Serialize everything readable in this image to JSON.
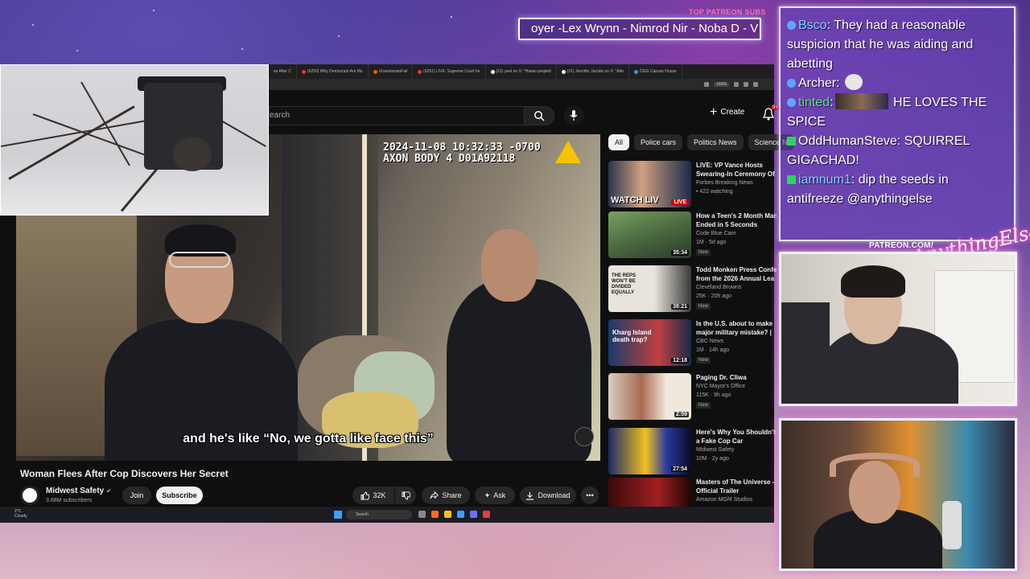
{
  "overlay": {
    "patreon_label": "TOP PATREON SUBS",
    "ticker_text": "oyer -Lex Wrynn - Nimrod Nir - Noba D - V",
    "patreon_url": "PATREON.COM/",
    "signature": "AnythingElse"
  },
  "browser": {
    "tabs": [
      {
        "label": "es After C"
      },
      {
        "label": "(6250) Why Democrats Are Mo"
      },
      {
        "label": "r/LivestreamFail"
      },
      {
        "label": "(6251) LIVE: Supreme Court he"
      },
      {
        "label": "(21) yeet on X: \"Hasan perpleti"
      },
      {
        "label": "(21) Jennifer Jacobs on X: \"Atto"
      },
      {
        "label": "DGG Canvas House"
      }
    ],
    "zoom": "160%"
  },
  "youtube": {
    "search_placeholder": "earch",
    "create_label": "Create",
    "notif_count": "9+",
    "video": {
      "timestamp": "2024-11-08 10:32:33 -0700",
      "device": "AXON BODY 4 D01A92118",
      "subtitle": "and he's like “No, we gotta like face this”",
      "title": "Woman Flees After Cop Discovers Her Secret",
      "channel": "Midwest Safety",
      "subscribers": "3.68M subscribers",
      "join_label": "Join",
      "subscribe_label": "Subscribe",
      "likes": "32K",
      "share_label": "Share",
      "ask_label": "Ask",
      "download_label": "Download"
    },
    "chips": [
      "All",
      "Police cars",
      "Politics News",
      "Science N"
    ],
    "related": [
      {
        "title1": "LIVE: VP Vance Hosts",
        "title2": "Swearing-In Ceremony Of",
        "channel": "Forbes Breaking News",
        "meta": "422 watching",
        "badge": "LIVE",
        "thumb_text": "WATCH LIV",
        "new": ""
      },
      {
        "title1": "How a Teen's 2 Month Man",
        "title2": "Ended in 5 Seconds",
        "channel": "Code Blue Cam",
        "meta": "1M · 5d ago",
        "badge": "35:34",
        "thumb_text": "",
        "new": "New"
      },
      {
        "title1": "Todd Monken Press Confe",
        "title2": "from the 2026 Annual Lea",
        "channel": "Cleveland Browns",
        "meta": "25K · 20h ago",
        "badge": "38:21",
        "thumb_text": "THE REPS WON'T BE DIVIDED EQUALLY",
        "new": "New"
      },
      {
        "title1": "Is the U.S. about to make",
        "title2": "major military mistake? |",
        "channel": "CBC News",
        "meta": "1M · 14h ago",
        "badge": "12:18",
        "thumb_text": "Kharg Island death trap?",
        "new": "New"
      },
      {
        "title1": "Paging Dr. Cliwa",
        "title2": "",
        "channel": "NYC Mayor's Office",
        "meta": "115K · 9h ago",
        "badge": "2:59",
        "thumb_text": "",
        "new": "New"
      },
      {
        "title1": "Here's Why You Shouldn't",
        "title2": "a Fake Cop Car",
        "channel": "Midwest Safety",
        "meta": "10M · 2y ago",
        "badge": "27:54",
        "thumb_text": "",
        "new": ""
      },
      {
        "title1": "Masters of The Universe -",
        "title2": "Official Trailer",
        "channel": "Amazon MGM Studios",
        "meta": "",
        "badge": "",
        "thumb_text": "",
        "new": ""
      }
    ]
  },
  "taskbar": {
    "weather_temp": "2°C",
    "weather_desc": "Cloudy",
    "search_label": "Search"
  },
  "chat": {
    "messages": [
      {
        "user": "Bsco",
        "text": "They had a reasonable suspicion that he was aiding and abetting",
        "user_color": "#7fd0ff",
        "badge": "dot"
      },
      {
        "user": "Archer",
        "text": "",
        "user_color": "#ffffff",
        "badge": "dot"
      },
      {
        "user": "tinted",
        "text": "HE LOVES THE SPICE",
        "user_color": "#5fe08a",
        "badge": "dot"
      },
      {
        "user": "OddHumanSteve",
        "text": "SQUIRREL GIGACHAD!",
        "user_color": "#ffffff",
        "badge": "k"
      },
      {
        "user": "iamnum1",
        "text": "dip the seeds in antifreeze @anythingelse",
        "user_color": "#7fd0ff",
        "badge": "k"
      }
    ]
  }
}
